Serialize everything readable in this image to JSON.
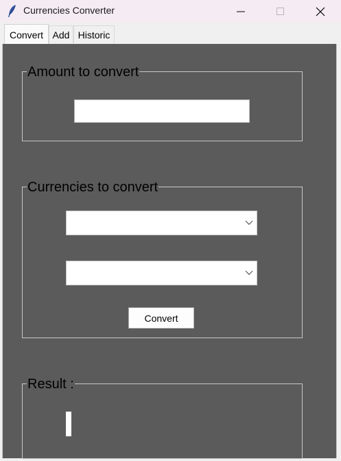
{
  "window": {
    "title": "Currencies Converter",
    "icon": "feather-icon"
  },
  "tabs": [
    {
      "label": "Convert",
      "active": true
    },
    {
      "label": "Add",
      "active": false
    },
    {
      "label": "Historic",
      "active": false
    }
  ],
  "amount_frame": {
    "label": "Amount to convert",
    "amount_value": ""
  },
  "currencies_frame": {
    "label": "Currencies to convert",
    "from_currency": "",
    "to_currency": "",
    "convert_label": "Convert"
  },
  "result_frame": {
    "label": "Result :",
    "value": ""
  },
  "colors": {
    "panel": "#5b5b5b",
    "titlebar": "#f5ecf3"
  }
}
